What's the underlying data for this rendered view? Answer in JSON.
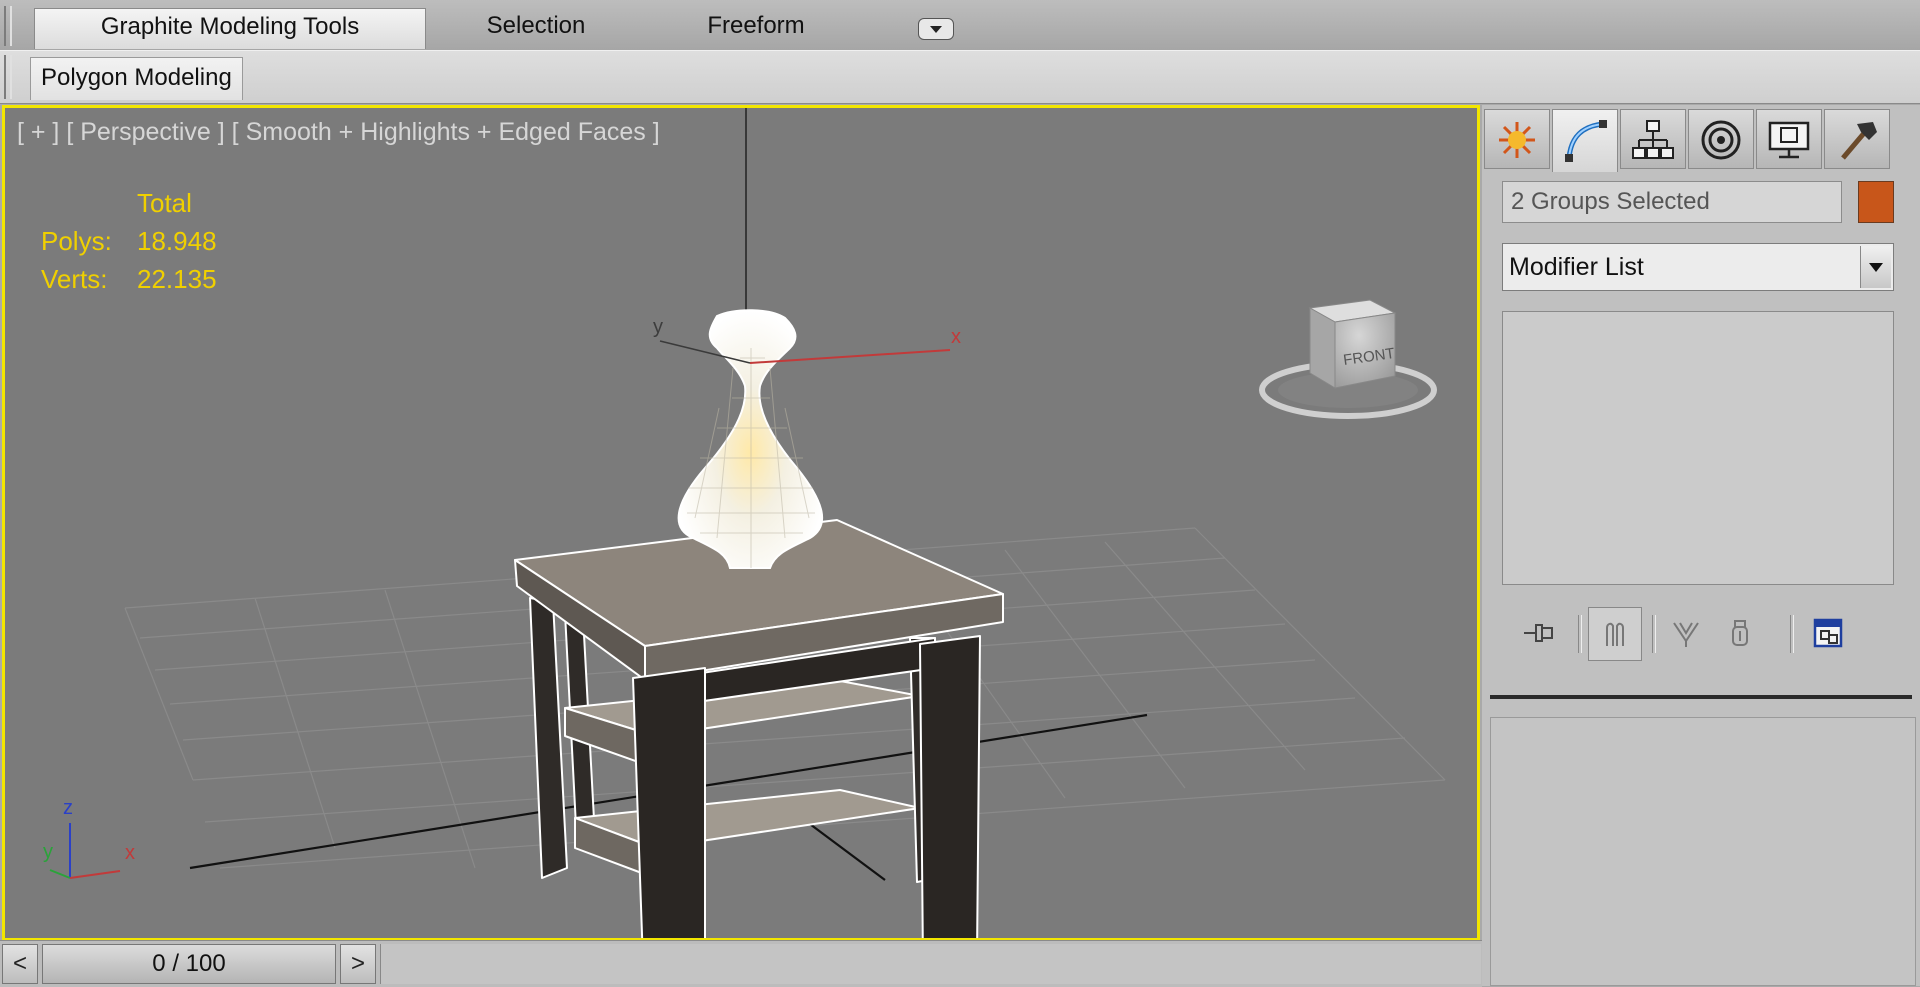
{
  "ribbon": {
    "tabs": [
      {
        "label": "Graphite Modeling Tools",
        "active": true
      },
      {
        "label": "Selection",
        "active": false
      },
      {
        "label": "Freeform",
        "active": false
      }
    ],
    "panel_tab": "Polygon Modeling"
  },
  "viewport": {
    "label": "[ + ] [ Perspective ] [ Smooth + Highlights + Edged Faces ]",
    "stats": {
      "header": "Total",
      "polys_label": "Polys:",
      "polys_value": "18.948",
      "verts_label": "Verts:",
      "verts_value": "22.135"
    },
    "gizmo": {
      "x": "x",
      "y": "y"
    },
    "axis_tripod": {
      "x": "x",
      "y": "y",
      "z": "z"
    },
    "viewcube_face": "FRONT",
    "border_color": "#f2e600",
    "stats_color": "#f0d000"
  },
  "timeline": {
    "prev": "<",
    "frame": "0 / 100",
    "next": ">"
  },
  "command_panel": {
    "tabs": [
      {
        "icon": "create-icon",
        "active": false
      },
      {
        "icon": "modify-icon",
        "active": true
      },
      {
        "icon": "hierarchy-icon",
        "active": false
      },
      {
        "icon": "motion-icon",
        "active": false
      },
      {
        "icon": "display-icon",
        "active": false
      },
      {
        "icon": "utilities-icon",
        "active": false
      }
    ],
    "selection_name": "2 Groups Selected",
    "object_color": "#c8561a",
    "modifier_list": "Modifier List",
    "stack_buttons": [
      "pin-stack-icon",
      "show-end-result-icon",
      "make-unique-icon",
      "remove-modifier-icon",
      "configure-modifier-sets-icon"
    ]
  }
}
